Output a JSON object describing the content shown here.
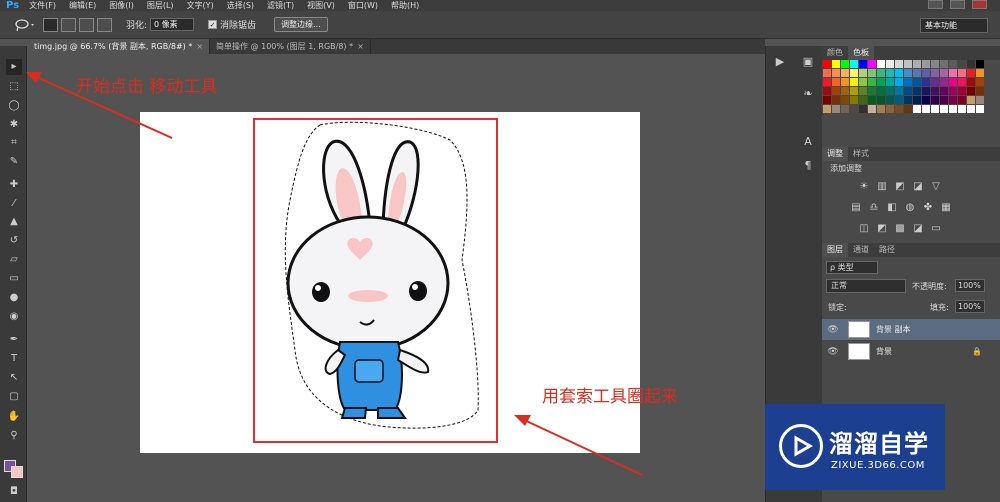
{
  "menubar": {
    "logo": "Ps",
    "items": [
      "文件(F)",
      "编辑(E)",
      "图像(I)",
      "图层(L)",
      "文字(Y)",
      "选择(S)",
      "滤镜(T)",
      "视图(V)",
      "窗口(W)",
      "帮助(H)"
    ]
  },
  "options": {
    "feather_label": "羽化:",
    "feather_value": "0 像素",
    "antialias_label": "消除锯齿",
    "refine_edge_label": "调整边缘...",
    "workspace": "基本功能"
  },
  "tabs": [
    {
      "label": "timg.jpg @ 66.7% (背景 副本, RGB/8#) *"
    },
    {
      "label": "简单操作 @ 100% (图层 1, RGB/8) *"
    }
  ],
  "annotations": {
    "top": "开始点击  移动工具",
    "bottom": "用套索工具圈起来"
  },
  "panels": {
    "color_tabs": [
      "颜色",
      "色板"
    ],
    "adjust_tabs": [
      "调整",
      "样式"
    ],
    "adjust_title": "添加调整",
    "layer_tabs": [
      "图层",
      "通道",
      "路径"
    ],
    "layer_filter": "ρ 类型",
    "blend_mode": "正常",
    "opacity_label": "不透明度:",
    "opacity_value": "100%",
    "lock_label": "锁定:",
    "fill_label": "填充:",
    "fill_value": "100%",
    "layers": [
      {
        "name": "背景 副本",
        "selected": true
      },
      {
        "name": "背景",
        "selected": false
      }
    ]
  },
  "watermark": {
    "cn": "溜溜自学",
    "url": "ZIXUE.3D66.COM"
  },
  "colors": {
    "foreground": "#7b4fa0",
    "background": "#f2c7c4",
    "annotation": "#d92d20"
  }
}
